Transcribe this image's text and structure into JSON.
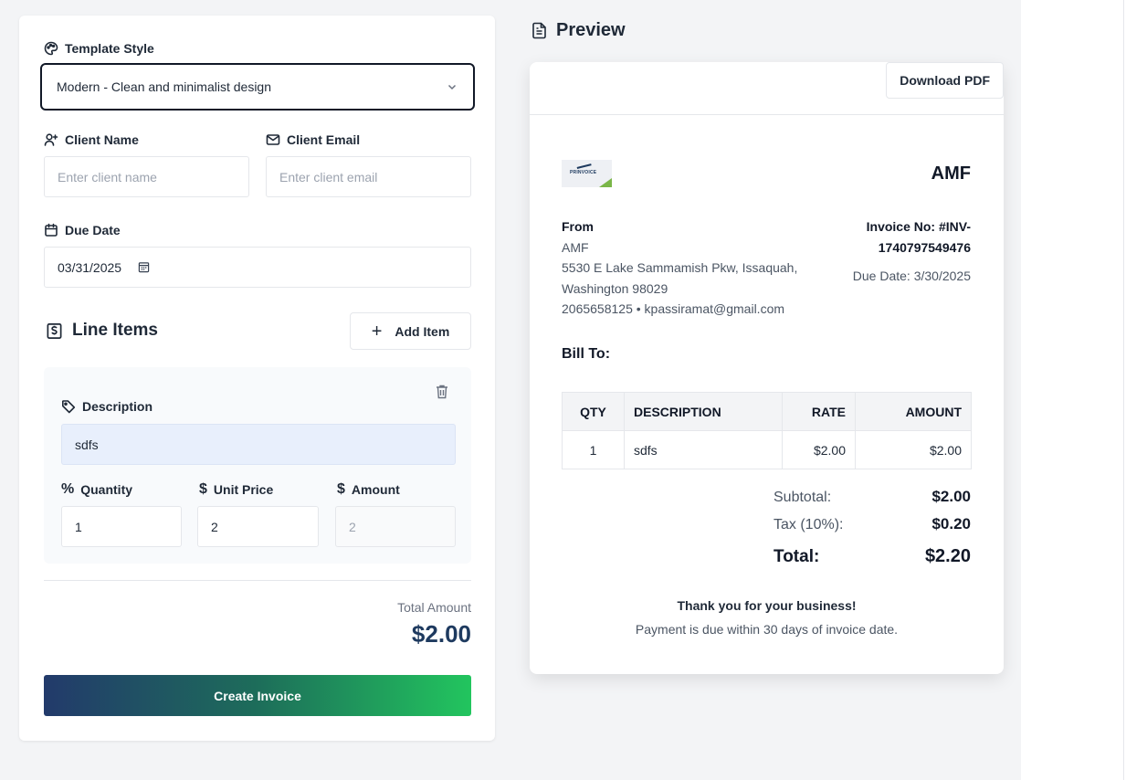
{
  "form": {
    "template_style": {
      "label": "Template Style",
      "value": "Modern - Clean and minimalist design"
    },
    "client_name": {
      "label": "Client Name",
      "placeholder": "Enter client name"
    },
    "client_email": {
      "label": "Client Email",
      "placeholder": "Enter client email"
    },
    "due_date": {
      "label": "Due Date",
      "value": "03/31/2025"
    },
    "line_items": {
      "title": "Line Items",
      "add_label": "Add Item",
      "items": [
        {
          "description_label": "Description",
          "description": "sdfs",
          "quantity_label": "Quantity",
          "quantity": "1",
          "unit_price_label": "Unit Price",
          "unit_price": "2",
          "amount_label": "Amount",
          "amount": "2"
        }
      ]
    },
    "total_amount_label": "Total Amount",
    "total_amount": "$2.00",
    "create_button": "Create Invoice"
  },
  "preview": {
    "heading": "Preview",
    "download_button": "Download PDF",
    "logo_text": "PRINVOICE",
    "company": "AMF",
    "from": {
      "heading": "From",
      "name": "AMF",
      "address_line1": "5530 E Lake Sammamish Pkw, Issaquah,",
      "address_line2": "Washington 98029",
      "contact": "2065658125 • kpassiramat@gmail.com"
    },
    "invoice_no_line1": "Invoice No: #INV-",
    "invoice_no_line2": "1740797549476",
    "due_date": "Due Date: 3/30/2025",
    "bill_to": "Bill To:",
    "table": {
      "headers": [
        "QTY",
        "DESCRIPTION",
        "RATE",
        "AMOUNT"
      ],
      "rows": [
        {
          "qty": "1",
          "description": "sdfs",
          "rate": "$2.00",
          "amount": "$2.00"
        }
      ]
    },
    "subtotal_label": "Subtotal:",
    "subtotal": "$2.00",
    "tax_label": "Tax (10%):",
    "tax": "$0.20",
    "total_label": "Total:",
    "total": "$2.20",
    "thanks": "Thank you for your business!",
    "terms": "Payment is due within 30 days of invoice date."
  }
}
